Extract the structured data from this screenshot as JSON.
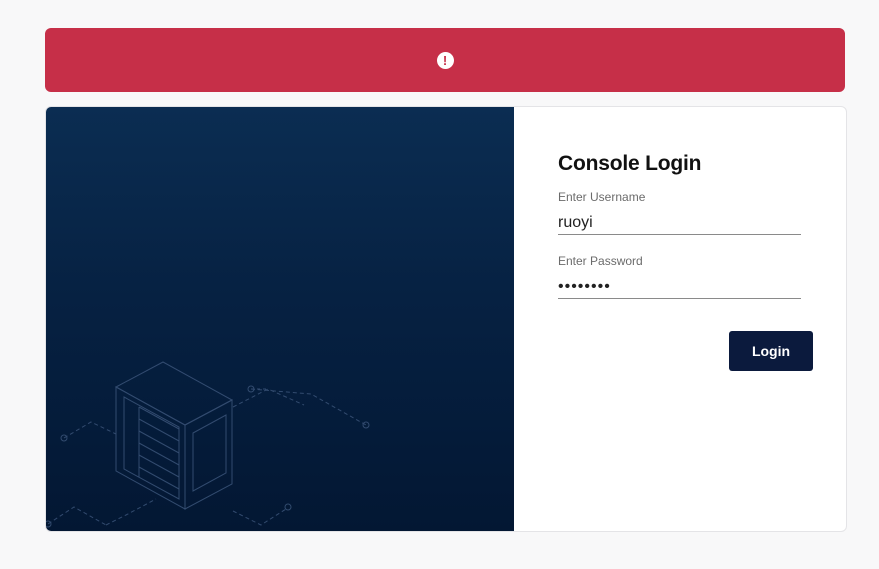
{
  "alert": {
    "color": "#c62f48",
    "icon": "exclamation-circle-icon",
    "icon_glyph": "!"
  },
  "hero": {
    "illustration": "server-rack-icon"
  },
  "login": {
    "title": "Console Login",
    "username_label": "Enter Username",
    "username_value": "ruoyi",
    "password_label": "Enter Password",
    "password_value": "••••••••",
    "button_label": "Login"
  },
  "colors": {
    "button": "#0b1a3d",
    "hero_top": "#0b2d52",
    "hero_bottom": "#031733"
  }
}
